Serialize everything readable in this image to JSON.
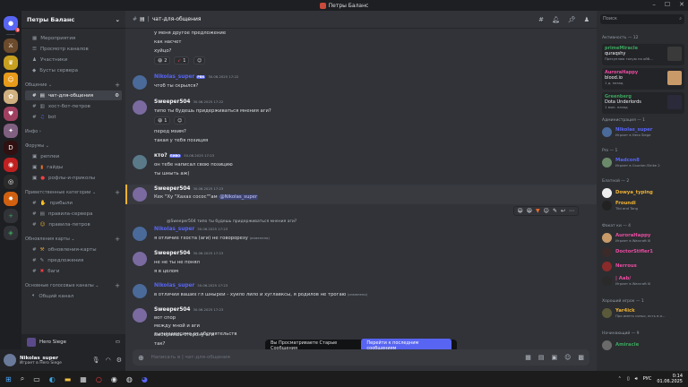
{
  "window": {
    "title": "Петры Баланс"
  },
  "guild": {
    "name": "Петры Баланс"
  },
  "nav": [
    "Мероприятия",
    "Просмотр каналов",
    "Участники",
    "Бусты сервера"
  ],
  "categories": {
    "general": "Общение",
    "info": "Инфо",
    "forums": "Форумы",
    "private": "Приветственные категории",
    "updates": "Обновления карты",
    "voice": "Основные голосовые каналы"
  },
  "channels": {
    "general": [
      "чат-для-общения",
      "хост-бот-петров",
      "bot"
    ],
    "forums": [
      "реплеи",
      "гайды",
      "рофлы-и-приколы"
    ],
    "private": [
      "прибыли",
      "правила-сервера",
      "правила-петров"
    ],
    "updates": [
      "обновления-карты",
      "предложения",
      "баги"
    ],
    "voice": [
      "Общий канал"
    ]
  },
  "voice_panel": {
    "name": "Hero Siege"
  },
  "user": {
    "name": "Nikolas_super",
    "status": "Играет в Hero Siege"
  },
  "header": {
    "channel": "чат-для-общения"
  },
  "messages": {
    "m0": {
      "lines": [
        "у меня другое предложение",
        "как насчет",
        "хуйцо?"
      ],
      "reactions": [
        "2",
        "1"
      ]
    },
    "m1": {
      "name": "Nikolas_super",
      "time": "30.06.2025 17:22",
      "tag": "РВК",
      "text": "чтоб ты скрылся?"
    },
    "m2": {
      "name": "Sweeper504",
      "time": "30.06.2025 17:22",
      "text": "типо ты будешь придерживаться мнения аги?",
      "reaction": "1"
    },
    "m2b": {
      "lines": [
        "перед мэим?",
        "такая у тебя позиция"
      ]
    },
    "m3": {
      "name": "кто?",
      "tag": "ПИВО",
      "time": "30.06.2025 17:23",
      "lines": [
        "он тебе написал свою позицию",
        "ты шныть аж)"
      ]
    },
    "m4": {
      "name": "Sweeper504",
      "time": "30.06.2025 17:23",
      "text": "Кек \"Ху \"Хахах сосос\"\"ам",
      "mention": "@Nikolas_super"
    },
    "m5": {
      "reply": "@Sweeper504 типо ты будешь придерживаться мнения аги?",
      "name": "Nikolas_super",
      "time": "30.06.2025 17:23",
      "text": "я отличие гхоста (аги) не говорорезу",
      "edited": "(изменено)"
    },
    "m6": {
      "name": "Sweeper504",
      "time": "30.06.2025 17:23",
      "lines": [
        "не не ты не понял",
        "я в целом"
      ]
    },
    "m7": {
      "name": "Nikolas_super",
      "time": "30.06.2025 17:23",
      "text": "в отличии ваших гл шныреи - хуило лило и хуглавксы, я родилов не трогаю",
      "edited": "(изменено)"
    },
    "m8": {
      "name": "Sweeper504",
      "time": "30.06.2025 17:23",
      "lines": [
        "вот спор",
        "между мной и аги",
        "ты независимо от обстоятельств",
        "выбераешь сторону аги",
        "так?"
      ]
    }
  },
  "old_banner": {
    "text": "Вы Просматриваете Старые Сообщения",
    "button": "Перейти к последним сообщениям"
  },
  "composer": {
    "placeholder": "Написать в  | чат-для-общения"
  },
  "members": {
    "search": "Поиск",
    "activity_hdr": "Активность — 12",
    "activities": [
      {
        "name": "primeMiracle",
        "game": "quraqshy",
        "sub": "Пресуплаю голую на ойб..."
      },
      {
        "name": "AuroraHappy",
        "game": "blood.io",
        "sub": "1 д. назад"
      },
      {
        "name": "Greenberg",
        "game": "Dota Underlords",
        "sub": "1 мин. назад"
      }
    ],
    "groups": [
      {
        "title": "Администрация — 1",
        "members": [
          {
            "name": "Nikolas_super",
            "sub": "Играет в Hero Siege",
            "color": "#5865f2"
          }
        ]
      },
      {
        "title": "Pro — 1",
        "members": [
          {
            "name": "Madcon8",
            "sub": "Играет в Counter-Strike 2",
            "color": "#3ba55c"
          }
        ]
      },
      {
        "title": "Блатной — 2",
        "members": [
          {
            "name": "Dowya_typing",
            "sub": "",
            "color": "#f0b232"
          },
          {
            "name": "Froundi",
            "sub": "Tibi and Tong",
            "color": "#f0b232"
          }
        ]
      },
      {
        "title": "Факат ки — 4",
        "members": [
          {
            "name": "AuroraHappy",
            "sub": "Играет в Warcraft III",
            "color": "#e84ca0"
          },
          {
            "name": "DoctorStifler1",
            "sub": "",
            "color": "#e84ca0"
          },
          {
            "name": "Nerrous",
            "sub": "",
            "color": "#e84ca0"
          },
          {
            "name": "| Aab/",
            "sub": "Играет в Warcraft III",
            "color": "#e84ca0"
          }
        ]
      },
      {
        "title": "Хороший игрок — 1",
        "members": [
          {
            "name": "Yar4ick",
            "sub": "Про иметь соньо, есть в и...",
            "color": "#f0b232"
          }
        ]
      },
      {
        "title": "Начинающий — 9",
        "members": [
          {
            "name": "Amiracle",
            "sub": "",
            "color": "#3ba55c"
          }
        ]
      }
    ]
  },
  "taskbar": {
    "lang": "РУС",
    "time": "0:14",
    "date": "01.06.2025"
  }
}
